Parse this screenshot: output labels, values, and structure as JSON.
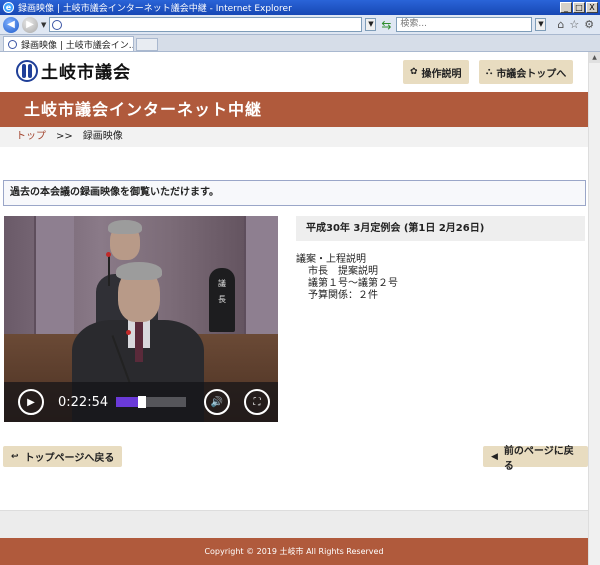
{
  "browser": {
    "window_title": "録画映像 | 土岐市議会インターネット議会中継 - Internet Explorer",
    "window_buttons": [
      "_",
      "□",
      "X"
    ],
    "search_placeholder": "検索...",
    "tab_label": "録画映像 | 土岐市議会イン..."
  },
  "header": {
    "logo_text": "土岐市議会",
    "buttons": [
      {
        "icon": "✿",
        "label": "操作説明"
      },
      {
        "icon": "⛬",
        "label": "市議会トップへ"
      }
    ]
  },
  "banner": {
    "title": "土岐市議会インターネット中継"
  },
  "breadcrumb": {
    "home": "トップ",
    "separator": ">>",
    "current": "録画映像"
  },
  "notice": {
    "text": "過去の本会議の録画映像を御覧いただけます。"
  },
  "video": {
    "nameplate": "議\n長",
    "time": "0:22:54",
    "progress": 0.32
  },
  "meeting": {
    "title": "平成30年 3月定例会 (第1日 2月26日)",
    "agenda": [
      "議案・上程説明",
      "市長　提案説明",
      "議第１号～議第２号",
      "予算関係：２件"
    ]
  },
  "nav": {
    "back_top": {
      "icon": "↩",
      "label": "トップページへ戻る"
    },
    "prev_page": {
      "icon": "◀",
      "label": "前のページに戻る"
    }
  },
  "footer": {
    "copyright": "Copyright © 2019 土岐市 All Rights Reserved"
  },
  "colors": {
    "brand": "#b05a3c",
    "button_bg": "#e8dcc0",
    "progress": "#6a3ad8"
  }
}
